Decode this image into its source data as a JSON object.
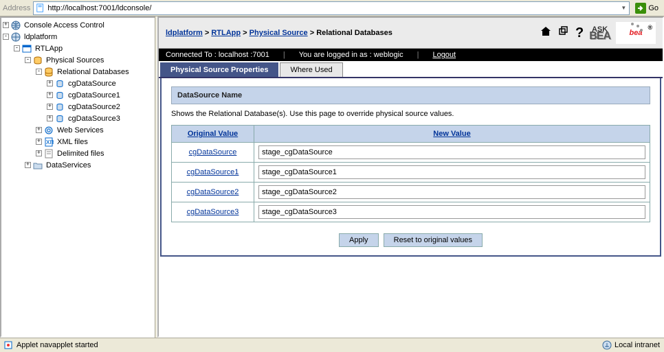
{
  "addressbar": {
    "label": "Address",
    "url": "http://localhost:7001/ldconsole/",
    "go": "Go"
  },
  "tree": {
    "n0": "Console Access Control",
    "n1": "ldplatform",
    "n2": "RTLApp",
    "n3": "Physical Sources",
    "n4": "Relational Databases",
    "n5": "cgDataSource",
    "n6": "cgDataSource1",
    "n7": "cgDataSource2",
    "n8": "cgDataSource3",
    "n9": "Web Services",
    "n10": "XML files",
    "n11": "Delimited files",
    "n12": "DataServices"
  },
  "breadcrumb": {
    "p0": "ldplatform",
    "p1": "RTLApp",
    "p2": "Physical Source",
    "p3": "Relational Databases"
  },
  "askbea": {
    "ask": "ASK",
    "bea": "BEA"
  },
  "logo": "bea",
  "status": {
    "connected": "Connected To :  localhost :7001",
    "loggedin": "You are logged in as :  weblogic",
    "logout": "Logout"
  },
  "tabs": {
    "t0": "Physical Source Properties",
    "t1": "Where Used"
  },
  "section": {
    "title": "DataSource Name",
    "desc": "Shows the Relational Database(s). Use this page to override physical source values.",
    "col_ov": "Original Value",
    "col_nv": "New Value"
  },
  "rows": {
    "r0": {
      "ov": "cgDataSource",
      "nv": "stage_cgDataSource"
    },
    "r1": {
      "ov": "cgDataSource1",
      "nv": "stage_cgDataSource1"
    },
    "r2": {
      "ov": "cgDataSource2",
      "nv": "stage_cgDataSource2"
    },
    "r3": {
      "ov": "cgDataSource3",
      "nv": "stage_cgDataSource3"
    }
  },
  "buttons": {
    "apply": "Apply",
    "reset": "Reset to original values"
  },
  "browser_status": {
    "left": "Applet navapplet started",
    "right": "Local intranet"
  }
}
